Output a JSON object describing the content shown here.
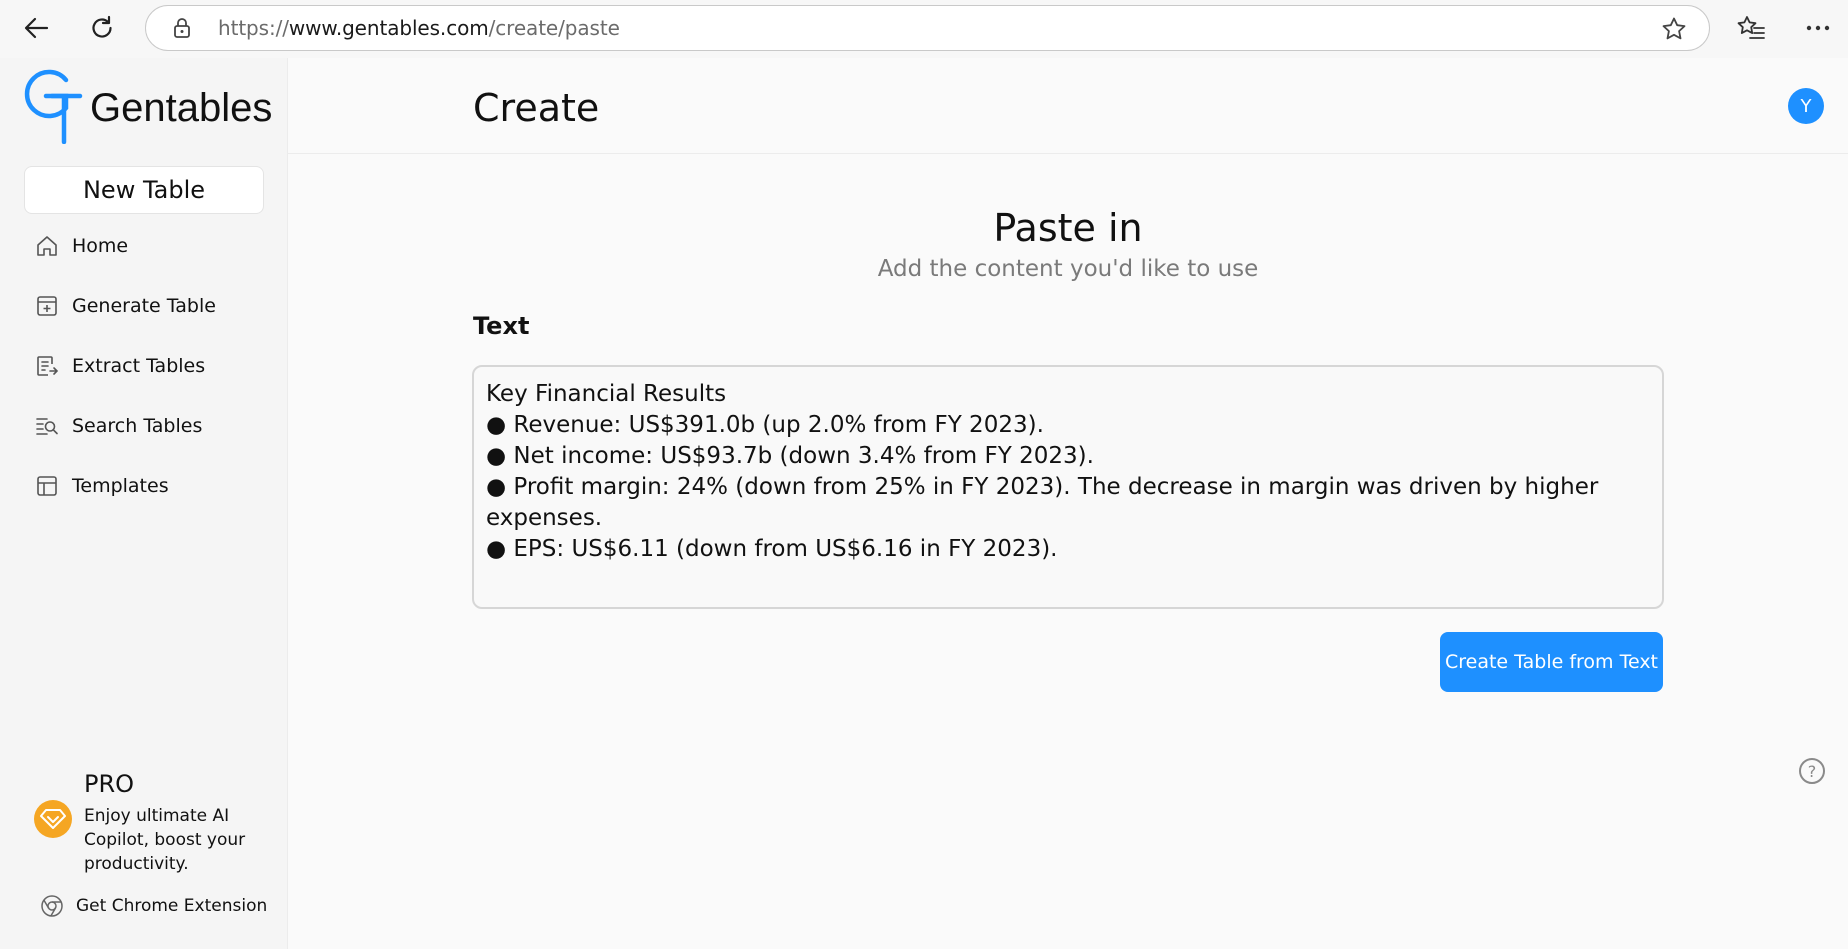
{
  "browser": {
    "url_prefix": "https://",
    "url_domain": "www.gentables.com",
    "url_path": "/create/paste"
  },
  "sidebar": {
    "logo_text": "Gentables",
    "new_table_label": "New Table",
    "items": [
      {
        "label": "Home",
        "icon": "home-icon"
      },
      {
        "label": "Generate Table",
        "icon": "generate-table-icon"
      },
      {
        "label": "Extract Tables",
        "icon": "extract-tables-icon"
      },
      {
        "label": "Search Tables",
        "icon": "search-tables-icon"
      },
      {
        "label": "Templates",
        "icon": "templates-icon"
      }
    ],
    "pro": {
      "title": "PRO",
      "description": "Enjoy ultimate AI Copilot, boost your productivity."
    },
    "chrome_extension_label": "Get Chrome Extension"
  },
  "header": {
    "title": "Create",
    "avatar_initial": "Y"
  },
  "main": {
    "section_title": "Paste in",
    "section_subtitle": "Add the content you'd like to use",
    "field_label": "Text",
    "text_value": "Key Financial Results\n● Revenue: US$391.0b (up 2.0% from FY 2023).\n● Net income: US$93.7b (down 3.4% from FY 2023).\n● Profit margin: 24% (down from 25% in FY 2023). The decrease in margin was driven by higher expenses.\n● EPS: US$6.11 (down from US$6.16 in FY 2023).",
    "create_button_label": "Create Table from Text",
    "help_label": "?"
  },
  "colors": {
    "accent": "#1e90ff",
    "pro_badge": "#f5a623"
  }
}
